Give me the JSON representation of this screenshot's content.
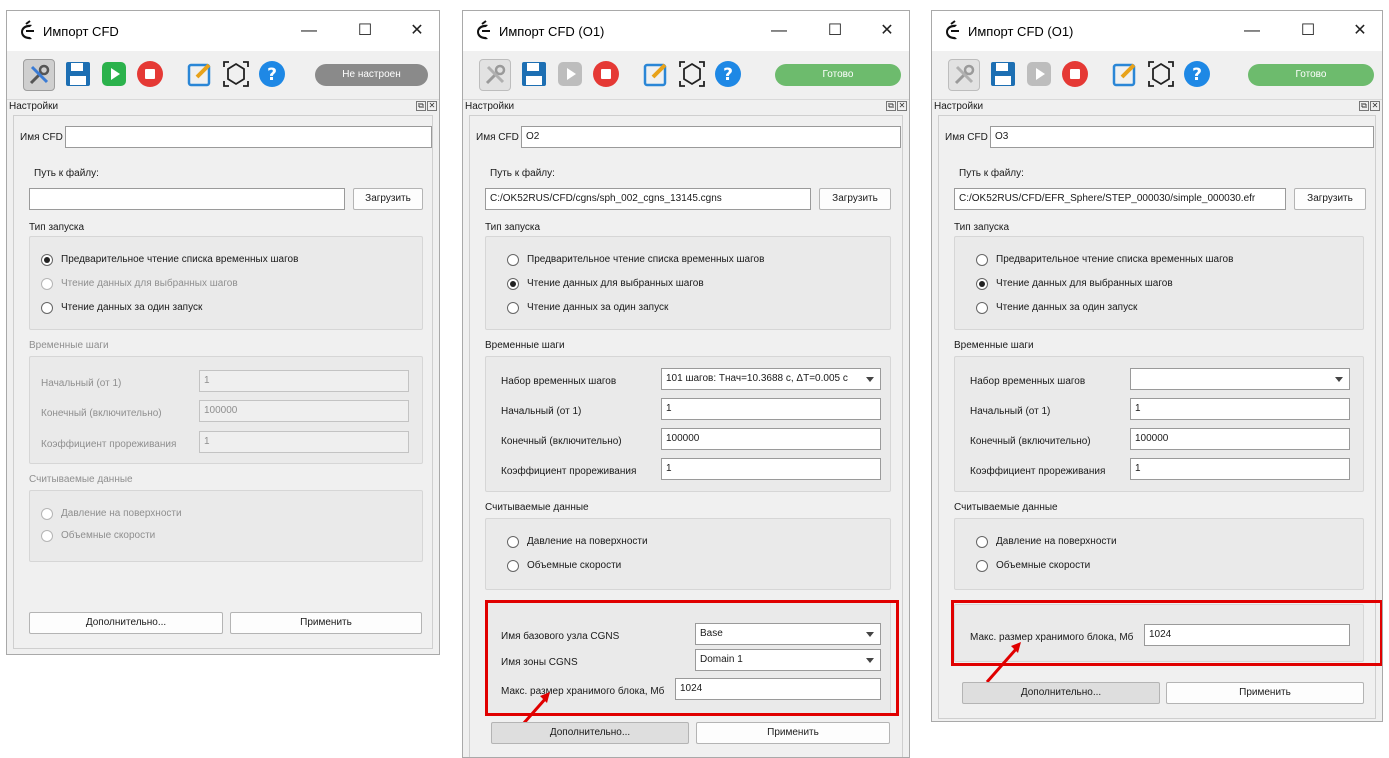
{
  "colors": {
    "status_gray": "#8a8a8a",
    "status_green": "#6dbb6d",
    "highlight_red": "#e00000",
    "save_blue": "#1d6fb3",
    "play_green": "#2bb24c",
    "stop_red": "#e53935",
    "edit_blue": "#2a86d6",
    "help_blue": "#1e88e5"
  },
  "windows": [
    {
      "title": "Импорт CFD",
      "status": "Не настроен",
      "panel_title": "Настройки",
      "cfd_name_label": "Имя CFD",
      "cfd_name": "",
      "file_path_label": "Путь к файлу:",
      "file_path": "",
      "load_button": "Загрузить",
      "launch_type_title": "Тип запуска",
      "radios": [
        "Предварительное чтение списка временных шагов",
        "Чтение данных для выбранных шагов",
        "Чтение данных за один запуск"
      ],
      "selected_launch": 0,
      "timesteps_title": "Временные шаги",
      "start_label": "Начальный (от 1)",
      "start_value": "1",
      "end_label": "Конечный (включительно)",
      "end_value": "100000",
      "thin_label": "Коэффициент прореживания",
      "thin_value": "1",
      "read_data_title": "Считываемые данные",
      "read_radios": [
        "Давление на поверхности",
        "Объемные скорости"
      ],
      "advanced_button": "Дополнительно...",
      "apply_button": "Применить"
    },
    {
      "title": "Импорт CFD (O1)",
      "status": "Готово",
      "panel_title": "Настройки",
      "cfd_name_label": "Имя CFD",
      "cfd_name": "O2",
      "file_path_label": "Путь к файлу:",
      "file_path": "C:/OK52RUS/CFD/cgns/sph_002_cgns_13145.cgns",
      "load_button": "Загрузить",
      "launch_type_title": "Тип запуска",
      "radios": [
        "Предварительное чтение списка временных шагов",
        "Чтение данных для выбранных шагов",
        "Чтение данных за один запуск"
      ],
      "selected_launch": 1,
      "timesteps_title": "Временные шаги",
      "set_label": "Набор временных шагов",
      "set_value": "101 шагов: Тнач=10.3688 с, ΔT=0.005 с",
      "start_label": "Начальный (от 1)",
      "start_value": "1",
      "end_label": "Конечный (включительно)",
      "end_value": "100000",
      "thin_label": "Коэффициент прореживания",
      "thin_value": "1",
      "read_data_title": "Считываемые данные",
      "read_radios": [
        "Давление на поверхности",
        "Объемные скорости"
      ],
      "base_node_label": "Имя базового узла CGNS",
      "base_node_value": "Base",
      "zone_label": "Имя зоны CGNS",
      "zone_value": "Domain 1",
      "block_label": "Макс. размер хранимого блока, Мб",
      "block_value": "1024",
      "advanced_button": "Дополнительно...",
      "apply_button": "Применить"
    },
    {
      "title": "Импорт CFD (O1)",
      "status": "Готово",
      "panel_title": "Настройки",
      "cfd_name_label": "Имя CFD",
      "cfd_name": "O3",
      "file_path_label": "Путь к файлу:",
      "file_path": "C:/OK52RUS/CFD/EFR_Sphere/STEP_000030/simple_000030.efr",
      "load_button": "Загрузить",
      "launch_type_title": "Тип запуска",
      "radios": [
        "Предварительное чтение списка временных шагов",
        "Чтение данных для выбранных шагов",
        "Чтение данных за один запуск"
      ],
      "selected_launch": 1,
      "timesteps_title": "Временные шаги",
      "set_label": "Набор временных шагов",
      "set_value": "",
      "start_label": "Начальный (от 1)",
      "start_value": "1",
      "end_label": "Конечный (включительно)",
      "end_value": "100000",
      "thin_label": "Коэффициент прореживания",
      "thin_value": "1",
      "read_data_title": "Считываемые данные",
      "read_radios": [
        "Давление на поверхности",
        "Объемные скорости"
      ],
      "block_label": "Макс. размер хранимого блока, Мб",
      "block_value": "1024",
      "advanced_button": "Дополнительно...",
      "apply_button": "Применить"
    }
  ]
}
